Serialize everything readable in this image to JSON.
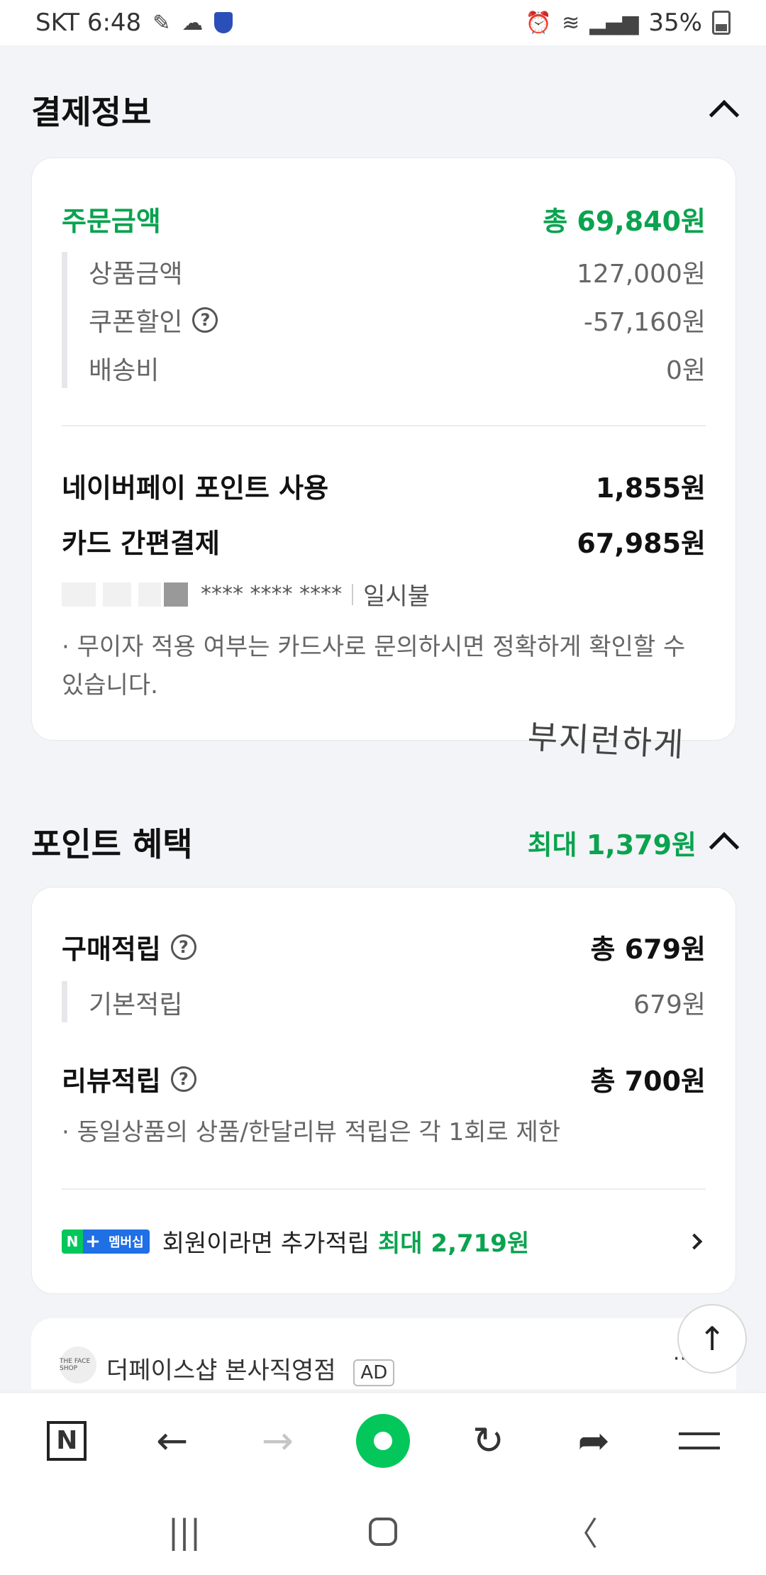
{
  "status": {
    "carrier_time": "SKT 6:48",
    "battery": "35%"
  },
  "payment": {
    "section_title": "결제정보",
    "order_label": "주문금액",
    "order_total": "총 69,840원",
    "items": [
      {
        "label": "상품금액",
        "value": "127,000원"
      },
      {
        "label": "쿠폰할인",
        "value": "-57,160원"
      },
      {
        "label": "배송비",
        "value": "0원"
      }
    ],
    "points_label": "네이버페이 포인트 사용",
    "points_value": "1,855원",
    "card_label": "카드 간편결제",
    "card_value": "67,985원",
    "card_number": "**** **** ****",
    "installment": "일시불",
    "note": "· 무이자 적용 여부는 카드사로 문의하시면 정확하게 확인할 수 있습니다.",
    "watermark": "부지런하게"
  },
  "benefit": {
    "section_title": "포인트 혜택",
    "max_label": "최대 1,379원",
    "purchase_label": "구매적립",
    "purchase_total": "총 679원",
    "basic_label": "기본적립",
    "basic_value": "679원",
    "review_label": "리뷰적립",
    "review_total": "총 700원",
    "review_note": "· 동일상품의 상품/한달리뷰 적립은 각 1회로 제한",
    "membership_badge": "멤버십",
    "membership_text": "회원이라면 추가적립",
    "membership_max": "최대 2,719원"
  },
  "ad": {
    "logo_text": "THE FACE SHOP",
    "store_name": "더페이스샵 본사직영점",
    "badge": "AD",
    "more": "··"
  },
  "toolbar": {
    "n_label": "N",
    "back": "←",
    "forward": "→",
    "refresh": "↻",
    "share": "➦",
    "scroll_top": "↑"
  },
  "nav": {
    "recents": "|||",
    "back": "〈"
  }
}
